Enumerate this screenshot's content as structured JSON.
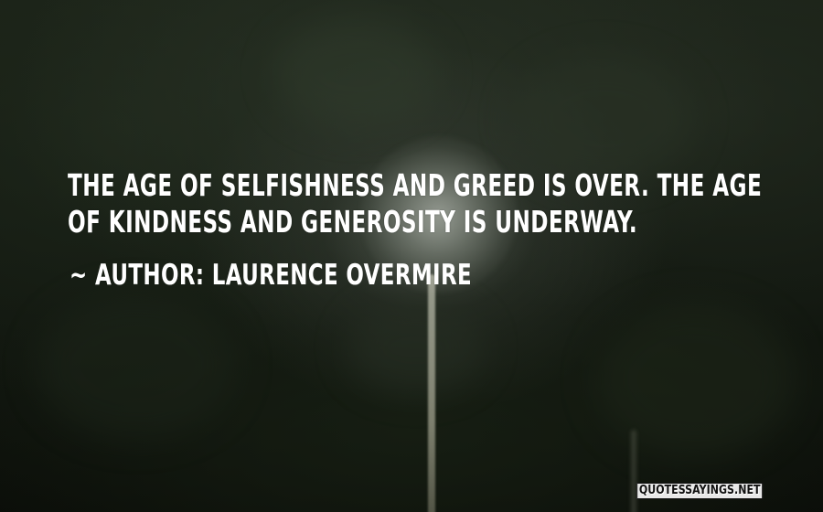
{
  "quote": {
    "line1": "THE AGE OF SELFISHNESS AND GREED IS OVER. THE AGE",
    "line2": "OF KINDNESS AND GENEROSITY IS UNDERWAY."
  },
  "author": {
    "label": "~ AUTHOR: LAURENCE OVERMIRE"
  },
  "watermark": {
    "text": "QUOTESSAYINGS.NET"
  },
  "colors": {
    "text": "#ffffff",
    "background": "#141a12"
  }
}
